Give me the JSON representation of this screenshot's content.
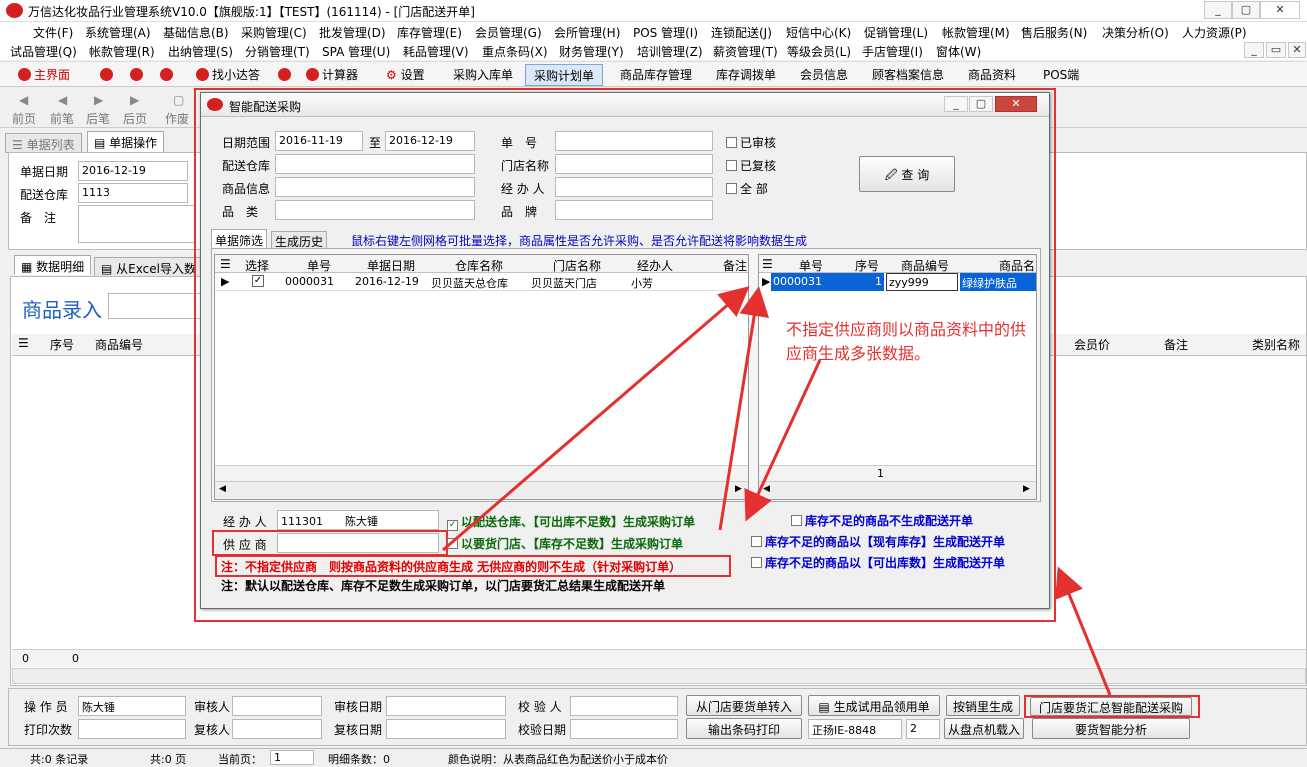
{
  "window": {
    "title": "万信达化妆品行业管理系统V10.0【旗舰版:1】【TEST】(161114) - [门店配送开单]",
    "min": "▭",
    "max": "▢",
    "close": "✕"
  },
  "menu1": [
    "文件(F)",
    "系统管理(A)",
    "基础信息(B)",
    "采购管理(C)",
    "批发管理(D)",
    "库存管理(E)",
    "会员管理(G)",
    "会所管理(H)",
    "POS 管理(I)",
    "连锁配送(J)",
    "短信中心(K)",
    "促销管理(L)",
    "帐款管理(M)",
    "售后服务(N)",
    "决策分析(O)",
    "人力资源(P)"
  ],
  "menu2": [
    "试品管理(Q)",
    "帐款管理(R)",
    "出纳管理(S)",
    "分销管理(T)",
    "SPA 管理(U)",
    "耗品管理(V)",
    "重点条码(X)",
    "财务管理(Y)",
    "培训管理(Z)",
    "薪资管理(T)",
    "等级会员(L)",
    "手店管理(I)",
    "窗体(W)"
  ],
  "toolbar1": {
    "main": "主界面",
    "find": "找小达答",
    "calc": "计算器",
    "settings": "设置",
    "purchase_in": "采购入库单",
    "purchase_plan": "采购计划单",
    "stock_mgmt": "商品库存管理",
    "transfer": "库存调拨单",
    "member": "会员信息",
    "customer": "顾客档案信息",
    "goods": "商品资料",
    "pos": "POS端"
  },
  "toolbar2": {
    "prev_page": "前页",
    "prev": "前笔",
    "next": "后笔",
    "next_page": "后页",
    "void": "作废"
  },
  "bg": {
    "tab_list": "单据列表",
    "tab_op": "单据操作",
    "date_label": "单据日期",
    "date_val": "2016-12-19",
    "wh_label": "配送仓库",
    "wh_val": "1113",
    "remark_label": "备　注",
    "tab_detail": "数据明细",
    "tab_excel": "从Excel导入数",
    "entry": "商品录入",
    "cols": {
      "seq": "序号",
      "code": "商品编号",
      "member_price": "会员价",
      "remark": "备注",
      "category": "类别名称"
    },
    "footer_left": "0",
    "footer_right": "0",
    "operator_label": "操 作 员",
    "operator_val": "陈大锤",
    "reviewer_label": "审核人",
    "review_date_label": "审核日期",
    "checker_label": "校 验 人",
    "print_label": "打印次数",
    "rechecker_label": "复核人",
    "recheck_date_label": "复核日期",
    "check_date_label": "校验日期",
    "btn_from_store": "从门店要货单转入",
    "btn_gen_trial": "生成试用品领用单",
    "btn_by_sale": "按销里生成",
    "btn_smart": "门店要货汇总智能配送采购",
    "btn_print": "输出条码打印",
    "btn_scanner": "正扬IE-8848",
    "spin_val": "2",
    "btn_inventory": "从盘点机载入",
    "btn_analysis": "要货智能分析"
  },
  "dialog": {
    "title": "智能配送采购",
    "date_label": "日期范围",
    "date_from": "2016-11-19",
    "to": "至",
    "date_to": "2016-12-19",
    "wh_label": "配送仓库",
    "goods_label": "商品信息",
    "category_label": "品　类",
    "no_label": "单　号",
    "store_label": "门店名称",
    "handler_label": "经 办 人",
    "brand_label": "品　牌",
    "cb_audited": "已审核",
    "cb_rechecked": "已复核",
    "cb_all": "全 部",
    "query": "查 询",
    "tab_filter": "单据筛选",
    "tab_history": "生成历史",
    "hint": "鼠标右键左侧网格可批量选择，商品属性是否允许采购、是否允许配送将影响数据生成",
    "left_cols": {
      "select": "选择",
      "no": "单号",
      "date": "单据日期",
      "wh": "仓库名称",
      "store": "门店名称",
      "handler": "经办人",
      "remark": "备注"
    },
    "left_row": {
      "no": "0000031",
      "date": "2016-12-19",
      "wh": "贝贝蓝天总仓库",
      "store": "贝贝蓝天门店",
      "handler": "小芳"
    },
    "right_cols": {
      "no": "单号",
      "seq": "序号",
      "code": "商品编号",
      "name": "商品名"
    },
    "right_row": {
      "no": "0000031",
      "seq": "1",
      "code": "zyy999",
      "name": "绿绿护肤品"
    },
    "right_footer": "1",
    "handler2_label": "经 办 人",
    "handler2_code": "111301",
    "handler2_name": "陈大锤",
    "supplier_label": "供 应 商",
    "opt1": "以配送仓库、【可出库不足数】生成采购订单",
    "opt2": "以要货门店、【库存不足数】生成采购订单",
    "opt3": "库存不足的商品不生成配送开单",
    "opt4": "库存不足的商品以【现有库存】生成配送开单",
    "opt5": "库存不足的商品以【可出库数】生成配送开单",
    "note1": "注：不指定供应商　则按商品资料的供应商生成 无供应商的则不生成（针对采购订单）",
    "note2": "注：默认以配送仓库、库存不足数生成采购订单，以门店要货汇总结果生成配送开单"
  },
  "annotation": "不指定供应商则以商品资料中的供应商生成多张数据。",
  "status": {
    "records": "共:0 条记录",
    "pages": "共:0 页",
    "current_label": "当前页：",
    "current_val": "1",
    "detail": "明细条数：0",
    "color_note": "颜色说明：从表商品红色为配送价小于成本价"
  },
  "colors": {
    "accent_red": "#e53030",
    "selected_blue": "#0a64d8",
    "note_red": "#e00000"
  }
}
